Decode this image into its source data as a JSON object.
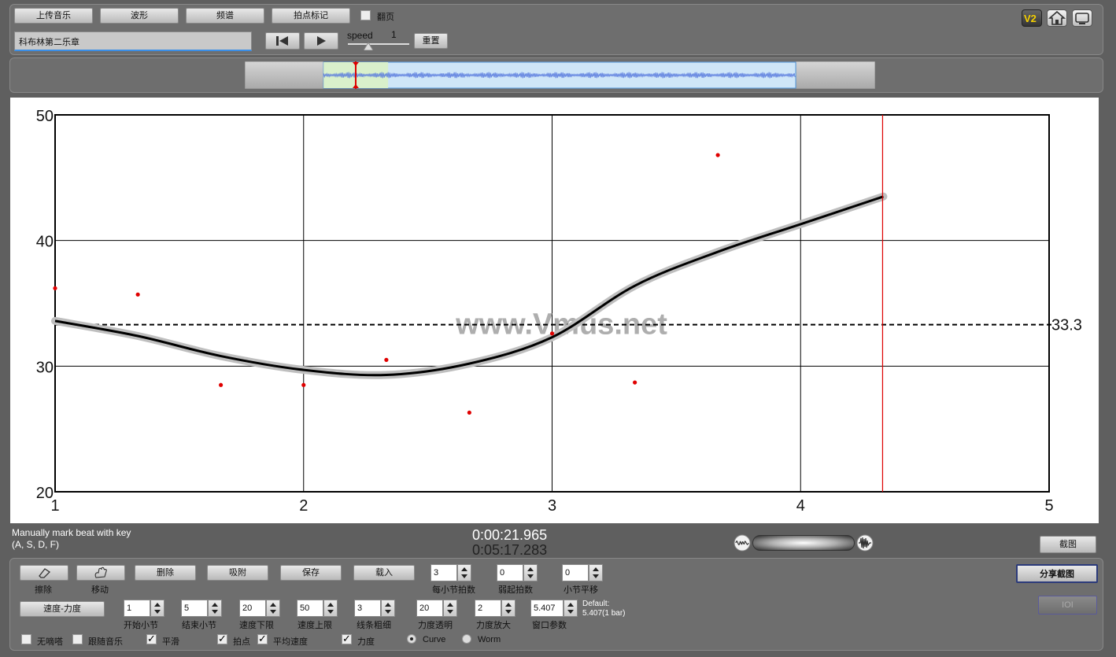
{
  "toolbar": {
    "upload_label": "上传音乐",
    "waveform_label": "波形",
    "spectrum_label": "频谱",
    "beat_mark_label": "拍点标记",
    "page_flip_label": "翻页",
    "page_flip_checked": false,
    "track_name": "科布林第二乐章",
    "speed_label": "speed",
    "speed_value": "1",
    "reset_label": "重置",
    "version_badge": "V2",
    "home_icon": "home-icon",
    "screen_icon": "screen-icon"
  },
  "overview": {
    "window_start_fraction": 0.125,
    "window_end_fraction": 0.874,
    "playhead_fraction": 0.176
  },
  "chart_data": {
    "type": "line",
    "title": "",
    "xlabel": "",
    "ylabel": "",
    "xlim": [
      1,
      5
    ],
    "ylim": [
      20,
      50
    ],
    "x_ticks": [
      "1",
      "2",
      "3",
      "4",
      "5"
    ],
    "y_ticks": [
      "20",
      "30",
      "40",
      "50"
    ],
    "grid": true,
    "mean_value": 33.3,
    "mean_label": "33.3",
    "watermark": "www.Vmus.net",
    "playhead_x": 4.33,
    "points": [
      [
        1.0,
        36.2
      ],
      [
        1.333,
        35.7
      ],
      [
        1.667,
        28.5
      ],
      [
        2.0,
        28.5
      ],
      [
        2.333,
        30.5
      ],
      [
        2.667,
        26.3
      ],
      [
        3.0,
        32.6
      ],
      [
        3.333,
        28.7
      ],
      [
        3.667,
        46.8
      ]
    ],
    "curve": [
      [
        1.0,
        33.6
      ],
      [
        1.333,
        32.4
      ],
      [
        1.667,
        30.8
      ],
      [
        2.0,
        29.7
      ],
      [
        2.333,
        29.3
      ],
      [
        2.667,
        30.2
      ],
      [
        3.0,
        32.3
      ],
      [
        3.333,
        36.4
      ],
      [
        3.667,
        39.1
      ],
      [
        4.0,
        41.3
      ],
      [
        4.333,
        43.5
      ]
    ]
  },
  "status": {
    "hint_line1": "Manually mark beat with key",
    "hint_line2": "(A, S, D, F)",
    "current_time": "0:00:21.965",
    "total_time": "0:05:17.283",
    "screenshot_label": "截图"
  },
  "controls": {
    "erase_label": "擦除",
    "move_label": "移动",
    "delete_label": "删除",
    "snap_label": "吸附",
    "save_label": "保存",
    "load_label": "载入",
    "beats_per_bar": {
      "value": "3",
      "label": "每小节拍数"
    },
    "pickup_beats": {
      "value": "0",
      "label": "弱起拍数"
    },
    "bar_shift": {
      "value": "0",
      "label": "小节平移"
    },
    "mode_label": "速度-力度",
    "start_bar": {
      "value": "1",
      "label": "开始小节"
    },
    "end_bar": {
      "value": "5",
      "label": "结束小节"
    },
    "tempo_min": {
      "value": "20",
      "label": "速度下限"
    },
    "tempo_max": {
      "value": "50",
      "label": "速度上限"
    },
    "line_width": {
      "value": "3",
      "label": "线条粗细"
    },
    "dynamics_opacity": {
      "value": "20",
      "label": "力度透明"
    },
    "dynamics_scale": {
      "value": "2",
      "label": "力度放大"
    },
    "window_param": {
      "value": "5.407",
      "label": "窗口参数"
    },
    "default_line1": "Default:",
    "default_line2": "5.407(1 bar)",
    "share_label": "分享截图",
    "ioi_label": "IOI",
    "no_click_label": "无嘀嗒",
    "follow_music_label": "跟随音乐",
    "smooth_label": "平滑",
    "beat_points_label": "拍点",
    "avg_tempo_label": "平均速度",
    "dynamics_label": "力度",
    "curve_label": "Curve",
    "worm_label": "Worm",
    "selected_mode": "Curve"
  }
}
